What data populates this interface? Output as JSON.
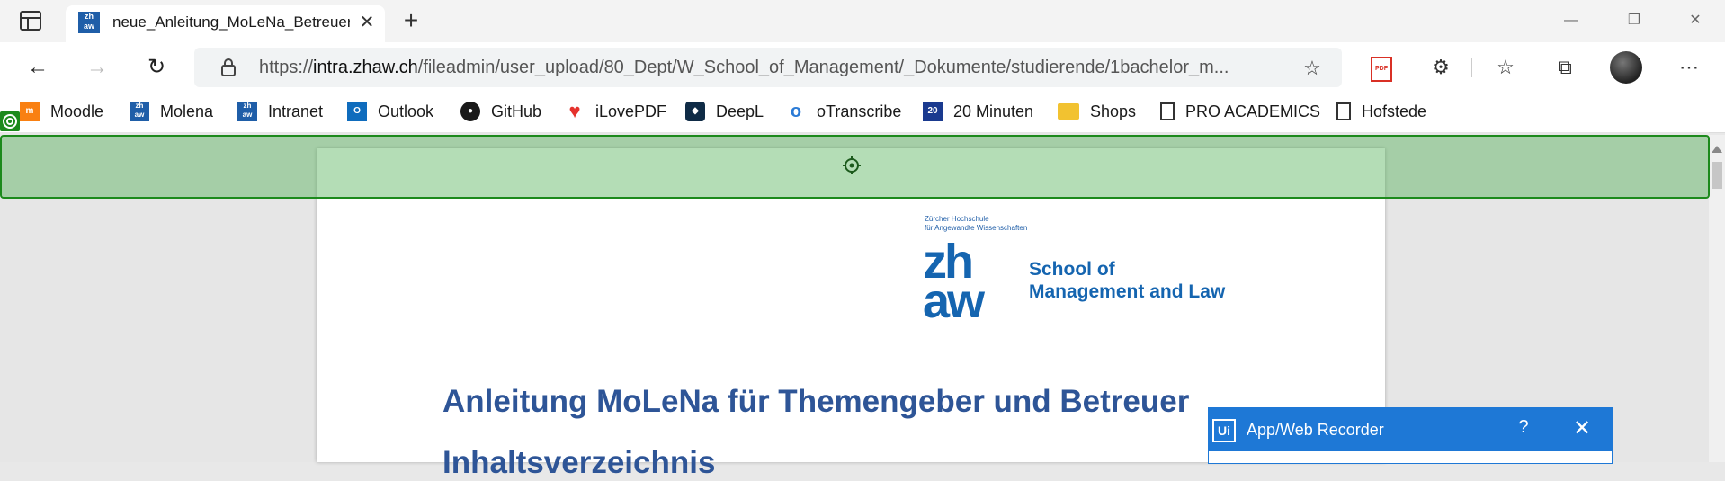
{
  "tab": {
    "title": "neue_Anleitung_MoLeNa_Betreuer",
    "favicon": "zhaw-icon"
  },
  "window": {
    "minimize": "—",
    "restore": "❐",
    "close": "✕"
  },
  "address": {
    "url_prefix": "https://",
    "url_domain": "intra.zhaw.ch",
    "url_rest": "/fileadmin/user_upload/80_Dept/W_School_of_Management/_Dokumente/studierende/1bachelor_m..."
  },
  "bookmarks": [
    {
      "label": "Moodle",
      "icon": "moodle-icon",
      "color": "#f98012"
    },
    {
      "label": "Molena",
      "icon": "zhaw-icon",
      "color": "#1f5ea8"
    },
    {
      "label": "Intranet",
      "icon": "zhaw-icon",
      "color": "#1f5ea8"
    },
    {
      "label": "Outlook",
      "icon": "outlook-icon",
      "color": "#0f6cbd"
    },
    {
      "label": "GitHub",
      "icon": "github-icon",
      "color": "#1a1a1a"
    },
    {
      "label": "iLovePDF",
      "icon": "heart-icon",
      "color": "#e5322d"
    },
    {
      "label": "DeepL",
      "icon": "deepl-icon",
      "color": "#0f2b46"
    },
    {
      "label": "oTranscribe",
      "icon": "otranscribe-icon",
      "color": "#2b7bd6"
    },
    {
      "label": "20 Minuten",
      "icon": "20min-icon",
      "color": "#1a3a8f"
    },
    {
      "label": "Shops",
      "icon": "folder-icon",
      "color": "#f2c230"
    },
    {
      "label": "PRO ACADEMICS",
      "icon": "page-icon",
      "color": "#333333"
    },
    {
      "label": "Hofstede",
      "icon": "page-icon",
      "color": "#333333"
    }
  ],
  "document": {
    "school_small_line1": "Zürcher Hochschule",
    "school_small_line2": "für Angewandte Wissenschaften",
    "logo_line1": "zh",
    "logo_line2": "aw",
    "school_name_line1": "School of",
    "school_name_line2": "Management and Law",
    "title": "Anleitung MoLeNa für Themengeber und Betreuer",
    "subtitle": "Inhaltsverzeichnis"
  },
  "recorder": {
    "logo": "Ui",
    "title": "App/Web Recorder",
    "help": "?",
    "close": "✕"
  },
  "colors": {
    "highlight": "#4caf50",
    "recorder_blue": "#1e78d6",
    "zhaw_blue": "#1565b0",
    "title_blue": "#2e5597"
  }
}
